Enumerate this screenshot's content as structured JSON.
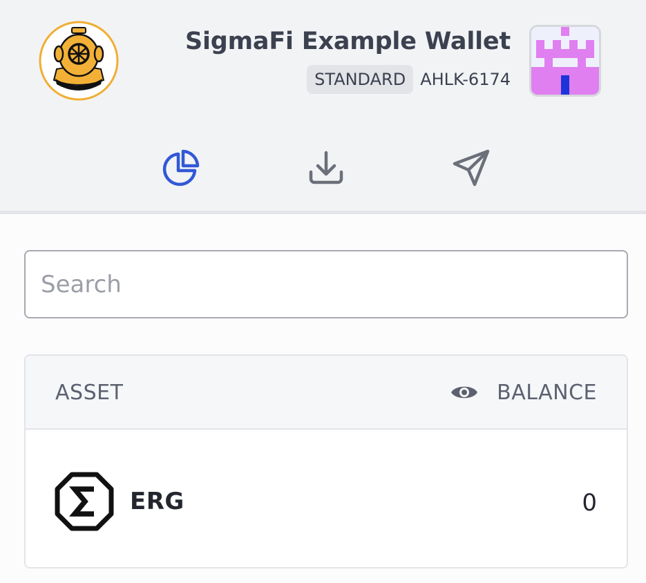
{
  "wallet": {
    "name": "SigmaFi Example Wallet",
    "type": "STANDARD",
    "checksum": "AHLK-6174"
  },
  "logo": {
    "icon": "diving-helmet-logo"
  },
  "tabs": [
    {
      "icon": "pie-chart-icon",
      "active": true
    },
    {
      "icon": "download-icon",
      "active": false
    },
    {
      "icon": "send-icon",
      "active": false
    }
  ],
  "search": {
    "placeholder": "Search",
    "value": ""
  },
  "assets_table": {
    "columns": {
      "asset": "ASSET",
      "balance": "BALANCE"
    },
    "rows": [
      {
        "name": "ERG",
        "balance": "0",
        "icon": "erg-icon"
      }
    ]
  },
  "colors": {
    "accent": "#3158d6",
    "header_bg": "#f2f3f5",
    "text": "#3c4150",
    "muted": "#5c6170"
  }
}
